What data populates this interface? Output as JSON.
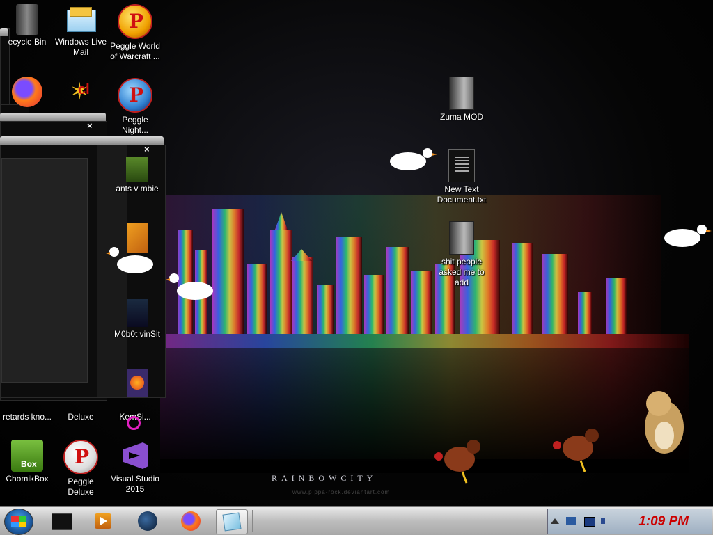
{
  "wallpaper": {
    "caption": "RAINBOWCITY",
    "subcaption": "www.pippa-rock.deviantart.com"
  },
  "desktop_icons": [
    {
      "name": "recycle-bin",
      "label": "ecycle Bin"
    },
    {
      "name": "windows-live-mail",
      "label": "Windows Live Mail"
    },
    {
      "name": "peggle-world-of-warcraft",
      "label": "Peggle World of Warcraft ..."
    },
    {
      "name": "peggle-nights",
      "label": "Peggle Night..."
    },
    {
      "name": "plants-vs-zombies",
      "label": "ants v mbie"
    },
    {
      "name": "m0b0t-site",
      "label": "M0b0t vinSit"
    },
    {
      "name": "retards-know",
      "label": "retards kno..."
    },
    {
      "name": "deluxe",
      "label": "Deluxe"
    },
    {
      "name": "kemsi",
      "label": "KemSi..."
    },
    {
      "name": "chomikbox",
      "label": "ChomikBox"
    },
    {
      "name": "peggle-deluxe",
      "label": "Peggle Deluxe"
    },
    {
      "name": "visual-studio-2015",
      "label": "Visual Studio 2015"
    },
    {
      "name": "zuma-mod",
      "label": "Zuma MOD"
    },
    {
      "name": "new-text-document",
      "label": "New Text Document.txt"
    },
    {
      "name": "shit-people-asked",
      "label": "shit people asked me to add"
    }
  ],
  "windows": {
    "close_glyph": "×"
  },
  "taskbar": {
    "clock": "1:09 PM",
    "buttons": [
      "Start",
      "Terminal",
      "Media Player",
      "Globe",
      "Firefox",
      "Notepad"
    ]
  },
  "colors": {
    "clock": "#cc0000",
    "taskbar": "#bdbdbd"
  }
}
